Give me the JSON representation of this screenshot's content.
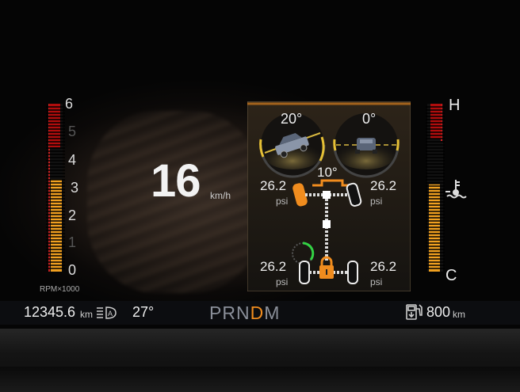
{
  "tachometer": {
    "ticks": [
      "6",
      "5",
      "4",
      "3",
      "2",
      "1",
      "0"
    ],
    "unit_label": "RPM×1000",
    "level_rpm_x1000": 3.3,
    "redline_from_rpm_x1000": 5.0
  },
  "speed": {
    "value": "16",
    "unit": "km/h"
  },
  "offroad_panel": {
    "pitch_angle": "20°",
    "roll_angle": "0°",
    "steering_angle": "10°",
    "tires": {
      "front_left": {
        "pressure": "26.2",
        "unit": "psi"
      },
      "front_right": {
        "pressure": "26.2",
        "unit": "psi"
      },
      "rear_left": {
        "pressure": "26.2",
        "unit": "psi"
      },
      "rear_right": {
        "pressure": "26.2",
        "unit": "psi"
      }
    },
    "accent_color": "#f08c1e",
    "active_color": "#33d244"
  },
  "temperature_gauge": {
    "hot_label": "H",
    "cold_label": "C",
    "level_fraction": 0.52
  },
  "status_bar": {
    "odometer": "12345.6",
    "odometer_unit": "km",
    "auto_lamp_icon": "auto-headlamp-icon",
    "outside_temp": "27°",
    "gear_letters": [
      "P",
      "R",
      "N",
      "D",
      "M"
    ],
    "selected_gear": "D",
    "range_icon": "fuel-range-icon",
    "range_value": "800",
    "range_unit": "km"
  }
}
